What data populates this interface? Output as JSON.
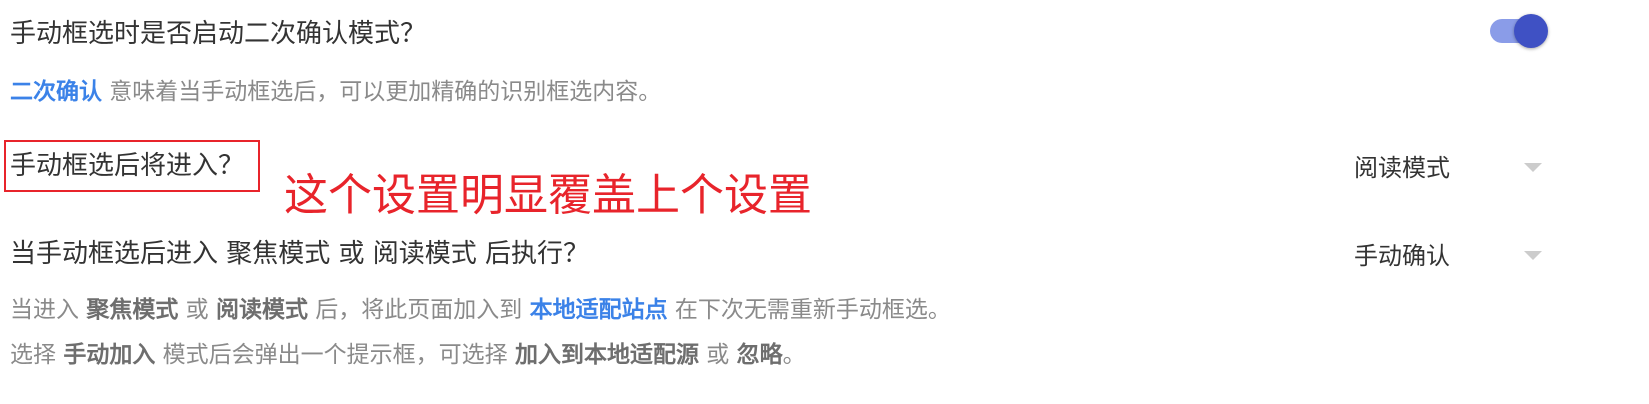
{
  "setting1": {
    "label": "手动框选时是否启动二次确认模式？",
    "hint_highlight": "二次确认",
    "hint_rest": " 意味着当手动框选后，可以更加精确的识别框选内容。",
    "enabled": true
  },
  "setting2": {
    "label": "手动框选后将进入？",
    "value": "阅读模式"
  },
  "annotation": {
    "text": "这个设置明显覆盖上个设置"
  },
  "setting3": {
    "label": "当手动框选后进入 聚焦模式 或 阅读模式 后执行？",
    "value": "手动确认",
    "hint1": {
      "p1": "当进入 ",
      "b1": "聚焦模式",
      "p2": " 或 ",
      "b2": "阅读模式",
      "p3": " 后，将此页面加入到 ",
      "blue": "本地适配站点",
      "p4": " 在下次无需重新手动框选。"
    },
    "hint2": {
      "p1": "选择 ",
      "b1": "手动加入",
      "p2": " 模式后会弹出一个提示框，可选择 ",
      "b2": "加入到本地适配源",
      "p3": " 或 ",
      "b3": "忽略",
      "p4": "。"
    }
  },
  "colors": {
    "accent": "#3f51c4",
    "link_blue": "#3b82e8",
    "annotation_red": "#e8242b"
  }
}
